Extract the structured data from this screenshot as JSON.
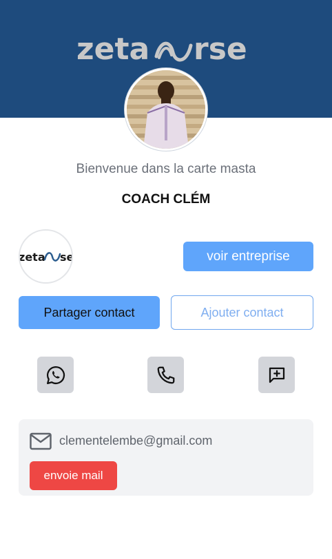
{
  "header": {
    "brand_name": "zetaverse",
    "brand_color": "#c8c8c8",
    "background_color": "#1e4b7d"
  },
  "profile": {
    "welcome_text": "Bienvenue dans la carte masta",
    "name": "COACH CLÉM"
  },
  "company": {
    "logo_text": "zetaverse",
    "button_label": "voir entreprise"
  },
  "contact_buttons": {
    "share_label": "Partager contact",
    "add_label": "Ajouter contact"
  },
  "actions": [
    {
      "icon": "whatsapp-icon"
    },
    {
      "icon": "phone-icon"
    },
    {
      "icon": "message-plus-icon"
    }
  ],
  "email": {
    "address": "clementelembe@gmail.com",
    "button_label": "envoie mail"
  },
  "colors": {
    "primary_blue": "#5fa5fb",
    "danger_red": "#ee4744"
  }
}
